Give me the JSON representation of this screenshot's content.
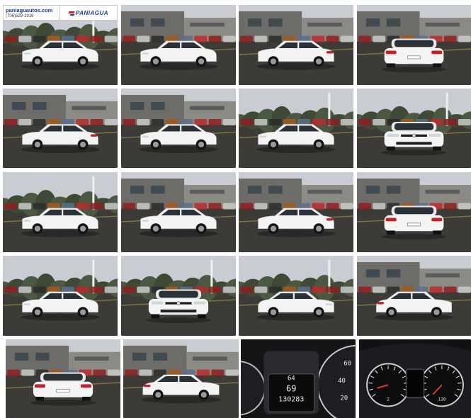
{
  "banner": {
    "website": "paniaguautos.com",
    "phone": "(706)529-1919",
    "logo_text": "PANIAGUA"
  },
  "gallery": {
    "photos": [
      {
        "view": "front-left",
        "scene": "lot-trees"
      },
      {
        "view": "side-left",
        "scene": "lot-building"
      },
      {
        "view": "rear-left",
        "scene": "lot-building"
      },
      {
        "view": "rear",
        "scene": "lot-building"
      },
      {
        "view": "rear-left",
        "scene": "lot-building"
      },
      {
        "view": "side-left",
        "scene": "lot-building"
      },
      {
        "view": "front-left",
        "scene": "lot-trees"
      },
      {
        "view": "front",
        "scene": "lot-trees"
      },
      {
        "view": "front-left",
        "scene": "lot-trees"
      },
      {
        "view": "side-left",
        "scene": "lot-building"
      },
      {
        "view": "rear-left",
        "scene": "lot-building"
      },
      {
        "view": "rear",
        "scene": "lot-building"
      },
      {
        "view": "front-left",
        "scene": "lot-trees"
      },
      {
        "view": "front",
        "scene": "lot-trees"
      },
      {
        "view": "front-right",
        "scene": "lot-trees"
      },
      {
        "view": "rear-right",
        "scene": "lot-building"
      },
      {
        "view": "rear",
        "scene": "lot-building"
      },
      {
        "view": "rear-right",
        "scene": "lot-building"
      },
      {
        "view": "dash-closeup",
        "scene": "interior"
      },
      {
        "view": "dash-cluster",
        "scene": "interior"
      }
    ]
  },
  "dashboard": {
    "temp": "64",
    "speed": "69",
    "odometer": "130283",
    "speedo_ticks": [
      "60",
      "40",
      "20"
    ],
    "gauge_left": "2",
    "gauge_right": "120"
  },
  "colors": {
    "car_body": "#f4f4f4",
    "tail_light": "#c0222b",
    "asphalt": "#3c3b38",
    "sky": "#c9ccd2",
    "accent": "#1a3f94"
  }
}
